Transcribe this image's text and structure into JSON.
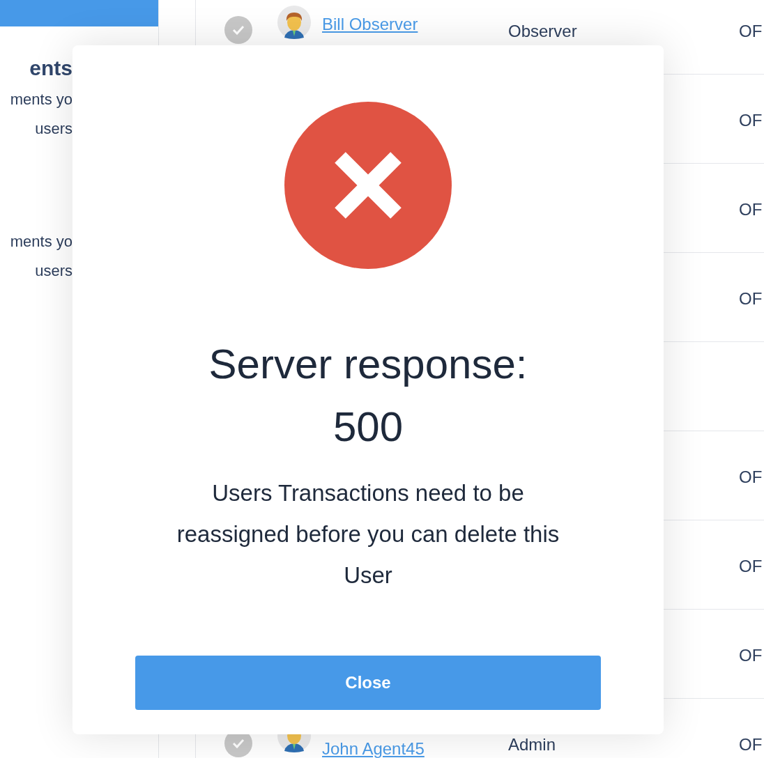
{
  "left_panel": {
    "heading": "ents",
    "lines": [
      "ments yo",
      "users",
      "ments yo",
      "users"
    ]
  },
  "table": {
    "rows": [
      {
        "name": "Bill Observer",
        "role": "Observer",
        "column_3": "OF"
      },
      {
        "column_3": "OF"
      },
      {
        "column_3": "OF"
      },
      {
        "column_3": "OF"
      },
      {},
      {
        "column_3": "OF"
      },
      {
        "column_3": "OF"
      },
      {
        "column_3": "OF"
      },
      {
        "name": "John Agent45",
        "role": "Admin",
        "column_3": "OF"
      }
    ]
  },
  "dialog": {
    "title": "Server response: 500",
    "message": "Users Transactions need to be reassigned before you can delete this User",
    "button": "Close"
  }
}
